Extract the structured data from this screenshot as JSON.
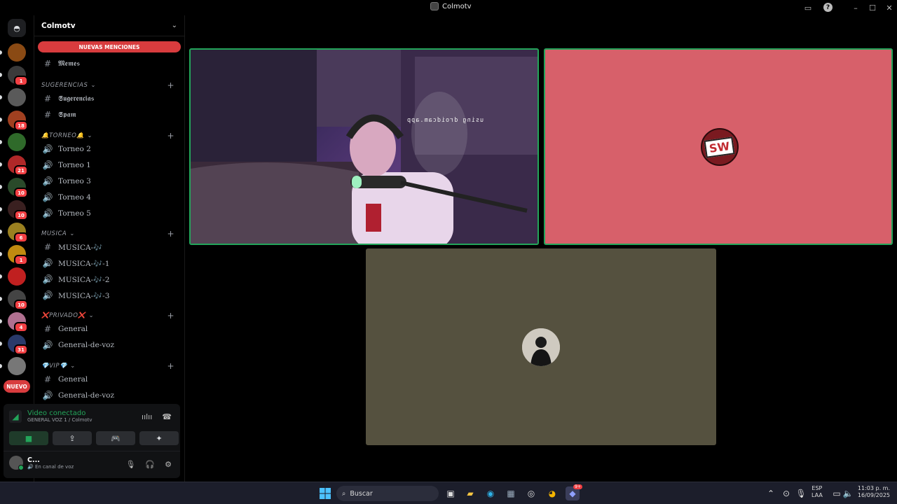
{
  "window": {
    "title": "Colmotv"
  },
  "server": {
    "name": "Colmotv",
    "mentions_label": "NUEVAS MENCIONES",
    "rail": [
      {
        "icon": "server-icon-tierra-dorada",
        "color": "#8a4a14",
        "badge": ""
      },
      {
        "icon": "server-icon-colmotv",
        "color": "#3a3a3a",
        "badge": "1"
      },
      {
        "icon": "server-icon-landscape",
        "color": "#5a5a5a",
        "badge": ""
      },
      {
        "icon": "server-icon-carnival",
        "color": "#a04020",
        "badge": "18"
      },
      {
        "icon": "server-icon-green",
        "color": "#2f6a2a",
        "badge": ""
      },
      {
        "icon": "server-icon-owl",
        "color": "#b02828",
        "badge": "21"
      },
      {
        "icon": "server-icon-plant",
        "color": "#2a4a2a",
        "badge": "10"
      },
      {
        "icon": "server-icon-dark",
        "color": "#3a2020",
        "badge": "10"
      },
      {
        "icon": "server-icon-gold-d",
        "color": "#9a8020",
        "badge": "6"
      },
      {
        "icon": "server-icon-ip",
        "color": "#c08a10",
        "badge": "1"
      },
      {
        "icon": "server-icon-rainbow",
        "color": "#c02020",
        "badge": ""
      },
      {
        "icon": "server-icon-grey",
        "color": "#444",
        "badge": "10"
      },
      {
        "icon": "server-icon-pink",
        "color": "#b07090",
        "badge": "4"
      },
      {
        "icon": "server-icon-blue",
        "color": "#2a3a6a",
        "badge": "31"
      },
      {
        "icon": "server-icon-bw",
        "color": "#777",
        "badge": ""
      }
    ],
    "new_label": "NUEVO"
  },
  "channels": [
    {
      "type": "text",
      "label": "𝕸𝖊𝖒𝖊𝖘",
      "icon": "hash-icon"
    },
    {
      "type": "category",
      "label": "SUGERENCIAS"
    },
    {
      "type": "text",
      "label": "𝕾𝖚𝖌𝖊𝖗𝖊𝖓𝖈𝖎𝖆𝖘",
      "icon": "hash-icon"
    },
    {
      "type": "text",
      "label": "𝕾𝖕𝖆𝖒",
      "icon": "hash-icon"
    },
    {
      "type": "category",
      "label": "🔔TORNEO🔔"
    },
    {
      "type": "voice",
      "label": "Torneo 2",
      "icon": "speaker-icon"
    },
    {
      "type": "voice",
      "label": "Torneo 1",
      "icon": "speaker-icon"
    },
    {
      "type": "voice",
      "label": "Torneo 3",
      "icon": "speaker-icon"
    },
    {
      "type": "voice",
      "label": "Torneo 4",
      "icon": "speaker-icon"
    },
    {
      "type": "voice",
      "label": "Torneo 5",
      "icon": "speaker-icon"
    },
    {
      "type": "category",
      "label": "MUSICA"
    },
    {
      "type": "text",
      "label": "MUSICA-🎶",
      "icon": "hash-icon"
    },
    {
      "type": "voice",
      "label": "MUSICA-🎶-1",
      "icon": "speaker-icon"
    },
    {
      "type": "voice",
      "label": "MUSICA-🎶-2",
      "icon": "speaker-icon"
    },
    {
      "type": "voice",
      "label": "MUSICA-🎶-3",
      "icon": "speaker-icon"
    },
    {
      "type": "category",
      "label": "❌PRIVADO❌"
    },
    {
      "type": "text",
      "label": "General",
      "icon": "hash-icon"
    },
    {
      "type": "voice",
      "label": "General-de-voz",
      "icon": "speaker-icon"
    },
    {
      "type": "category",
      "label": "💎VIP💎"
    },
    {
      "type": "text",
      "label": "General",
      "icon": "hash-icon"
    },
    {
      "type": "voice",
      "label": "General-de-voz",
      "icon": "speaker-icon"
    }
  ],
  "voice_panel": {
    "status": "Video conectado",
    "location": "GENERAL VOZ 1 / Colmotv",
    "user_name": "C...",
    "user_status": "En canal de voz"
  },
  "video": {
    "cam_watermark": "using droidcam.app",
    "sw_logo_text": "SW"
  },
  "taskbar": {
    "search_placeholder": "Buscar",
    "lang": "ESP",
    "layout": "LAA",
    "time": "11:03 p. m.",
    "date": "16/09/2025",
    "discord_badge": "9+"
  }
}
